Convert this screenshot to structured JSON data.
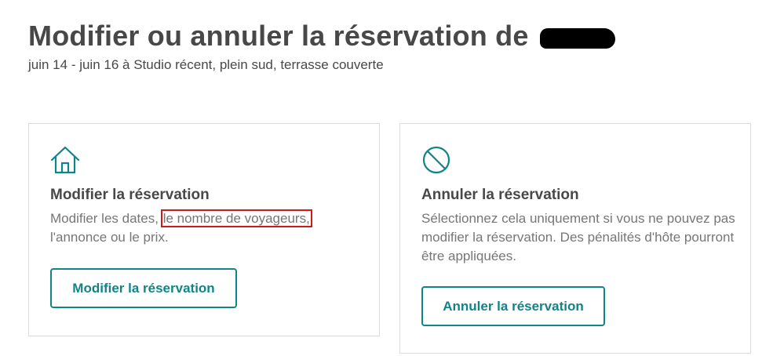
{
  "header": {
    "title": "Modifier ou annuler la réservation de",
    "subtitle": "juin 14 - juin 16 à Studio récent, plein sud, terrasse couverte"
  },
  "edit_card": {
    "icon": "home-icon",
    "title": "Modifier la réservation",
    "desc_before": "Modifier les dates,",
    "desc_highlight": "le nombre de voyageurs,",
    "desc_after": "l'annonce ou le prix.",
    "button_label": "Modifier la réservation"
  },
  "cancel_card": {
    "icon": "cancel-icon",
    "title": "Annuler la réservation",
    "description": "Sélectionnez cela uniquement si vous ne pouvez pas modifier la réservation. Des pénalités d'hôte pourront être appliquées.",
    "button_label": "Annuler la réservation"
  },
  "colors": {
    "accent": "#118488",
    "text": "#484848",
    "muted_text": "#767676",
    "highlight_box": "#d0191b",
    "card_border": "#dcdcdc"
  }
}
